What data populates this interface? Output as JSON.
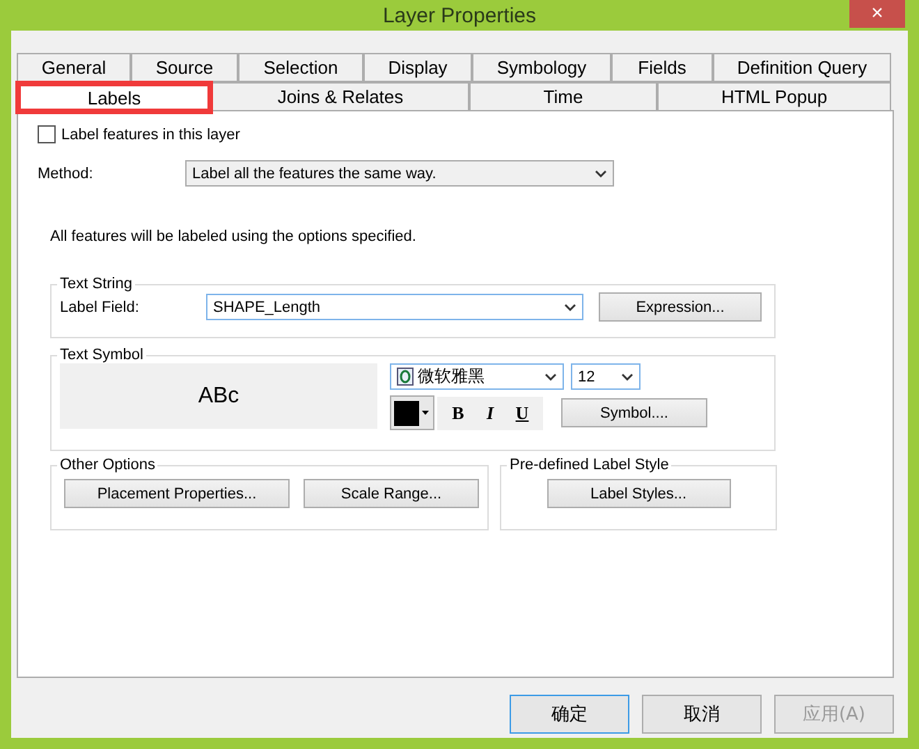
{
  "window": {
    "title": "Layer Properties",
    "close": "×"
  },
  "tab_rows": [
    [
      {
        "label": "General",
        "selected": false
      },
      {
        "label": "Source",
        "selected": false
      },
      {
        "label": "Selection",
        "selected": false
      },
      {
        "label": "Display",
        "selected": false
      },
      {
        "label": "Symbology",
        "selected": false
      },
      {
        "label": "Fields",
        "selected": false
      },
      {
        "label": "Definition Query",
        "selected": false
      }
    ],
    [
      {
        "label": "Labels",
        "selected": true,
        "highlighted": true
      },
      {
        "label": "Joins & Relates",
        "selected": false,
        "highlighted": false
      },
      {
        "label": "Time",
        "selected": false,
        "highlighted": false
      },
      {
        "label": "HTML Popup",
        "selected": false,
        "highlighted": false
      }
    ]
  ],
  "label_features": {
    "label": "Label features in this layer",
    "checked": false
  },
  "method": {
    "label": "Method:",
    "value": "Label all the features the same way."
  },
  "info": "All features will be labeled using the options specified.",
  "text_string": {
    "title": "Text String",
    "field_label": "Label Field:",
    "field_value": "SHAPE_Length",
    "button": "Expression..."
  },
  "text_symbol": {
    "title": "Text Symbol",
    "preview": "ABc",
    "font": "微软雅黑",
    "size": "12",
    "color": "#000000",
    "bold": "B",
    "italic": "I",
    "underline": "U",
    "button": "Symbol...."
  },
  "other_options": {
    "title": "Other Options",
    "buttons": [
      "Placement Properties...",
      "Scale Range..."
    ]
  },
  "predefined": {
    "title": "Pre-defined Label Style",
    "button": "Label Styles..."
  },
  "footer": [
    {
      "label": "确定",
      "disabled": false,
      "default": true
    },
    {
      "label": "取消",
      "disabled": false,
      "default": false
    },
    {
      "label": "应用(A)",
      "disabled": true,
      "default": false
    }
  ]
}
